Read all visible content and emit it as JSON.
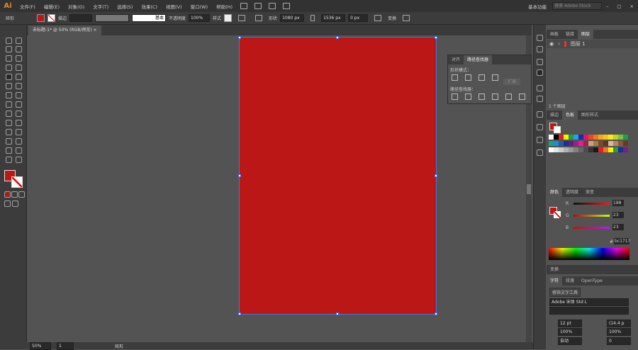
{
  "app": {
    "logo": "Ai",
    "menus": [
      "文件(F)",
      "编辑(E)",
      "对象(O)",
      "文字(T)",
      "选择(S)",
      "效果(C)",
      "视图(V)",
      "窗口(W)",
      "帮助(H)"
    ],
    "workspace": "基本功能",
    "search_placeholder": "搜索 Adobe Stock"
  },
  "control": {
    "selection": "矩形",
    "stroke_label": "描边",
    "stroke_style": "基本",
    "opacity_label": "不透明度",
    "opacity": "100%",
    "style_label": "样式",
    "shape_label": "形状",
    "width": "1080 px",
    "height": "1536 px",
    "corner": "0 px",
    "transform": "变换"
  },
  "document": {
    "tab": "未标题-1* @ 50% (RGB/预览)"
  },
  "artboard": {
    "fill": "#bc1717"
  },
  "status": {
    "zoom": "50%",
    "page": "1",
    "tool": "矩形"
  },
  "pathfinder": {
    "tabs": [
      "对齐",
      "路径查找器"
    ],
    "shape_modes": "形状模式：",
    "expand": "扩展",
    "pathfinders": "路径查找器："
  },
  "layers": {
    "tabs": [
      "画板",
      "链接",
      "图层"
    ],
    "layer_name": "图层 1",
    "count": "1 个图层"
  },
  "swatches": {
    "tabs": [
      "描边",
      "色板",
      "图形样式"
    ],
    "colors": [
      "#ffffff",
      "#000000",
      "#e81d1d",
      "#ffef00",
      "#21a038",
      "#1ea5e3",
      "#1d2aa0",
      "#e2147a",
      "#e84a1d",
      "#ec7a1d",
      "#f5a81d",
      "#f7c31d",
      "#f7e91d",
      "#bdd31d",
      "#7ac043",
      "#1d9e4a",
      "#1d9e89",
      "#1d8fc9",
      "#1d5fa8",
      "#1d2f8f",
      "#5e1d8f",
      "#9e1d8f",
      "#e81d8f",
      "#a81d4f",
      "#c8a27a",
      "#a87a4a",
      "#7a4a2a",
      "#5a3a1a",
      "#d8b8a0",
      "#b08868",
      "#8a5a38",
      "#6a3a18",
      "#ffffff",
      "#e5e5e5",
      "#cccccc",
      "#b2b2b2",
      "#999999",
      "#808080",
      "#666666",
      "#4d4d4d",
      "#333333",
      "#1a1a1a",
      "#e81d1d",
      "#ec7a1d",
      "#ffef00",
      "#21a038",
      "#1d2aa0",
      "#7a1d8f"
    ]
  },
  "color": {
    "tabs": [
      "颜色",
      "透明度",
      "渐变"
    ],
    "r_label": "R",
    "g_label": "G",
    "b_label": "B",
    "r": "188",
    "g": "23",
    "b": "23",
    "hex_label": "#",
    "hex": "bc1717"
  },
  "transform": {
    "title": "变换"
  },
  "character": {
    "tabs": [
      "字符",
      "段落",
      "OpenType"
    ],
    "touch_tool": "修饰文字工具",
    "font": "Adobe 宋体 Std L",
    "size": "12 pt",
    "leading": "(14.4 p",
    "vscale": "100%",
    "hscale": "100%",
    "kerning": "自动",
    "tracking": "0"
  }
}
